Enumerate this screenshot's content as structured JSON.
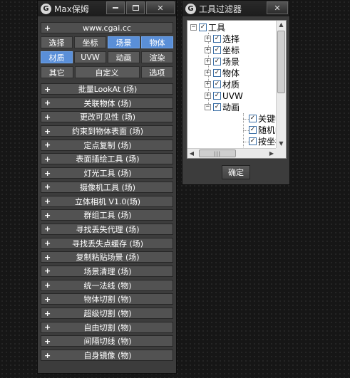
{
  "main_window": {
    "title": "Max保姆",
    "icon_glyph": "G",
    "website": "www.cgai.cc",
    "row1": [
      {
        "label": "选择",
        "active": false
      },
      {
        "label": "坐标",
        "active": false
      },
      {
        "label": "场景",
        "active": true
      },
      {
        "label": "物体",
        "active": true
      }
    ],
    "row2": [
      {
        "label": "材质",
        "active": true
      },
      {
        "label": "UVW",
        "active": false
      },
      {
        "label": "动画",
        "active": false
      },
      {
        "label": "渲染",
        "active": false
      }
    ],
    "row3": [
      {
        "label": "其它",
        "active": false
      },
      {
        "label": "自定义",
        "active": false
      },
      {
        "label": "选项",
        "active": false
      }
    ],
    "tools": [
      "批量LookAt (场)",
      "关联物体 (场)",
      "更改可见性 (场)",
      "约束到物体表面 (场)",
      "定点复制 (场)",
      "表面插绘工具 (场)",
      "灯光工具 (场)",
      "摄像机工具 (场)",
      "立体相机 V1.0(场)",
      "群组工具 (场)",
      "寻找丢失代理 (场)",
      "寻找丢失点缓存 (场)",
      "复制粘贴场景 (场)",
      "场景清理 (场)",
      "统一法线 (物)",
      "物体切割 (物)",
      "超级切割 (物)",
      "自由切割 (物)",
      "间隔切线 (物)",
      "自身镜像 (物)"
    ]
  },
  "filter_window": {
    "title": "工具过滤器",
    "icon_glyph": "G",
    "root": "工具",
    "children": [
      "选择",
      "坐标",
      "场景",
      "物体",
      "材质",
      "UVW",
      "动画"
    ],
    "anim_children": [
      "关键帧",
      "随机帧",
      "按坐标"
    ],
    "ok_label": "确定"
  },
  "icons": {
    "plus": "+",
    "check": "✓",
    "minus": "−",
    "close": "✕"
  },
  "colors": {
    "active_button": "#5a8fd8",
    "panel_bg": "#3c3c3c"
  }
}
